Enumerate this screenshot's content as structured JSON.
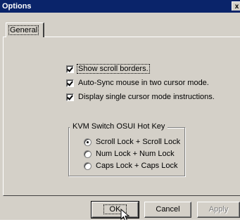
{
  "window": {
    "title": "Options",
    "close_glyph": "x"
  },
  "tabs": [
    {
      "label": "General",
      "selected": true
    }
  ],
  "options": [
    {
      "label": "Show scroll borders.",
      "checked": true,
      "focused": true
    },
    {
      "label": "Auto-Sync mouse in two cursor mode.",
      "checked": true
    },
    {
      "label": "Display single cursor mode instructions.",
      "checked": true
    }
  ],
  "hotkey_group": {
    "title": "KVM Switch OSUI Hot Key",
    "choices": [
      {
        "label": "Scroll Lock + Scroll Lock",
        "selected": true
      },
      {
        "label": "Num Lock + Num Lock",
        "selected": false
      },
      {
        "label": "Caps Lock + Caps Lock",
        "selected": false
      }
    ]
  },
  "buttons": {
    "ok": "OK",
    "cancel": "Cancel",
    "apply": "Apply"
  },
  "colors": {
    "titlebar": "#0a246a",
    "face": "#d4d0c8",
    "disabled_text": "#808080"
  },
  "icons": {
    "cursor": "mouse-pointer-icon",
    "close": "close-icon"
  }
}
